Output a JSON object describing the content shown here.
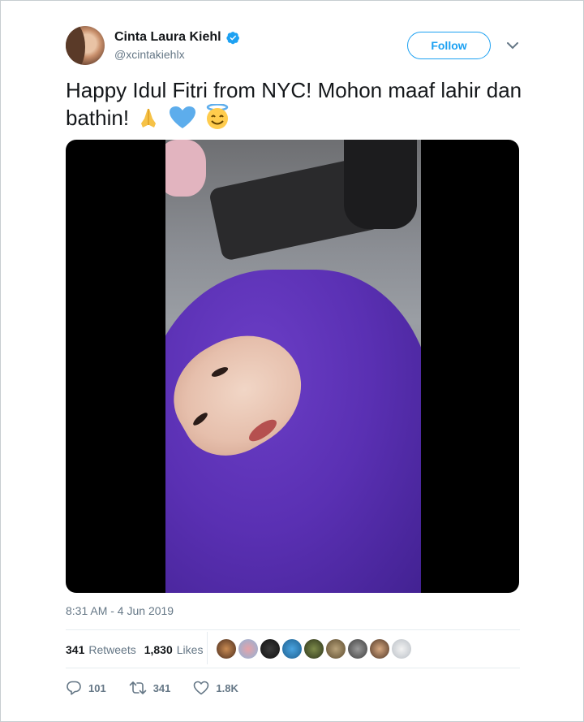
{
  "author": {
    "display_name": "Cinta Laura Kiehl",
    "handle": "@xcintakiehlx",
    "verified": true,
    "avatar_icon": "profile-photo"
  },
  "follow_label": "Follow",
  "tweet": {
    "text": "Happy Idul Fitri from NYC! Mohon maaf lahir dan bathin!",
    "emojis": [
      "folded-hands",
      "blue-heart",
      "smiling-face-with-halo"
    ]
  },
  "media": {
    "type": "video"
  },
  "timestamp": "8:31 AM - 4 Jun 2019",
  "stats": {
    "retweets_count": "341",
    "retweets_label": "Retweets",
    "likes_count": "1,830",
    "likes_label": "Likes"
  },
  "likers_count": 9,
  "actions": {
    "reply_count": "101",
    "retweet_count": "341",
    "like_count": "1.8K"
  },
  "colors": {
    "accent": "#1da1f2",
    "text": "#14171a",
    "muted": "#657786",
    "divider": "#e6ecf0"
  }
}
